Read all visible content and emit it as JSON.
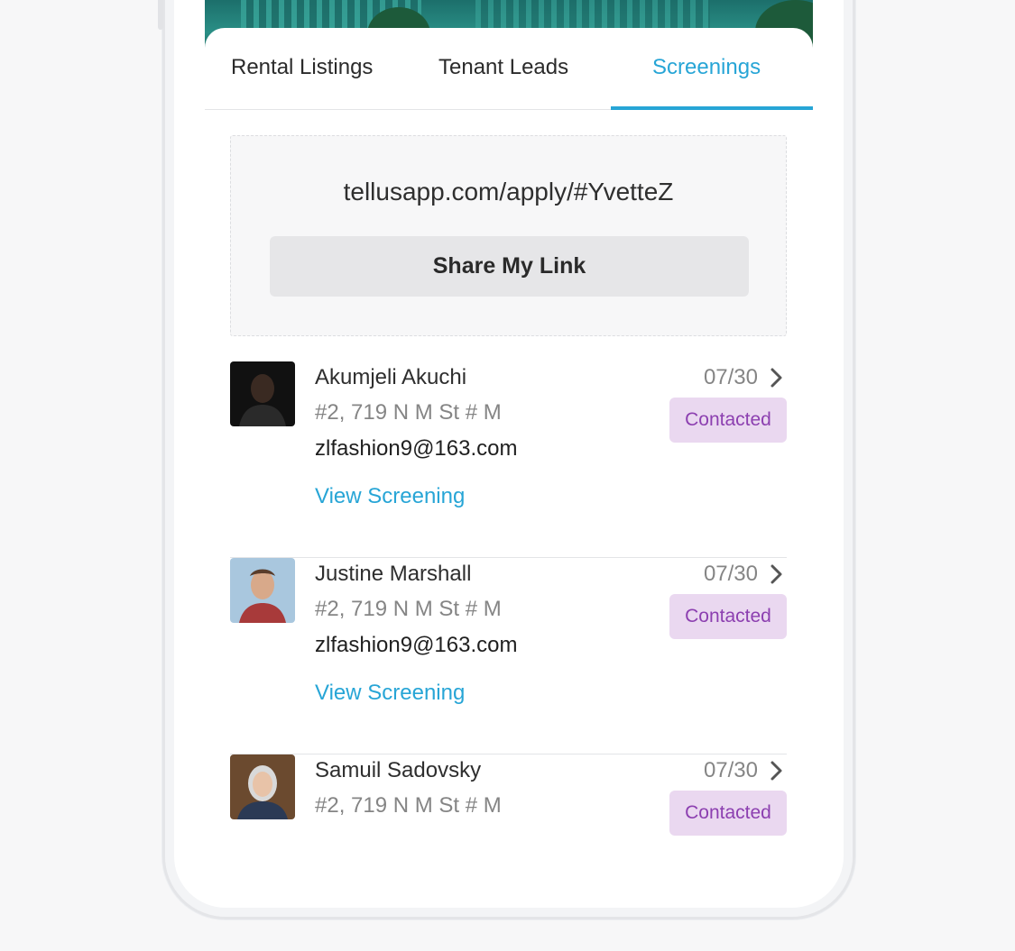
{
  "tabs": [
    {
      "label": "Rental Listings"
    },
    {
      "label": "Tenant Leads"
    },
    {
      "label": "Screenings"
    }
  ],
  "active_tab": "Screenings",
  "share": {
    "link": "tellusapp.com/apply/#YvetteZ",
    "button_label": "Share My Link"
  },
  "screenings": [
    {
      "name": "Akumjeli Akuchi",
      "address": "#2, 719 N M St # M",
      "email": "zlfashion9@163.com",
      "view_label": "View Screening",
      "date": "07/30",
      "status": "Contacted"
    },
    {
      "name": "Justine Marshall",
      "address": "#2, 719 N M St # M",
      "email": "zlfashion9@163.com",
      "view_label": "View Screening",
      "date": "07/30",
      "status": "Contacted"
    },
    {
      "name": "Samuil Sadovsky",
      "address": "#2, 719 N M St # M",
      "email": "",
      "view_label": "",
      "date": "07/30",
      "status": "Contacted"
    }
  ],
  "colors": {
    "accent": "#27a5d6",
    "badge_bg": "#ead8f0",
    "badge_text": "#8c3fb0"
  },
  "icons": {
    "row_chevron": "chevron-right-icon"
  }
}
